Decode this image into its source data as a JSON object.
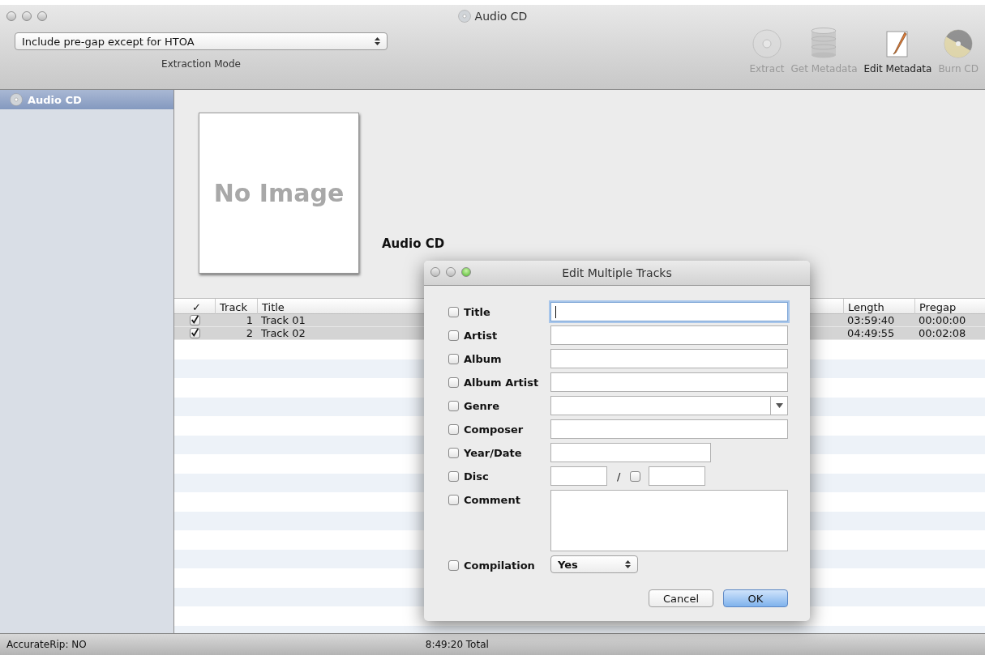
{
  "window": {
    "title": "Audio CD"
  },
  "toolbar": {
    "extraction_mode": {
      "value": "Include pre-gap except for HTOA",
      "label": "Extraction Mode"
    },
    "buttons": [
      {
        "kind": "extract",
        "label": "Extract",
        "disabled": true
      },
      {
        "kind": "metadata",
        "label": "Get Metadata",
        "disabled": true
      },
      {
        "kind": "edit",
        "label": "Edit Metadata",
        "disabled": false
      },
      {
        "kind": "burn",
        "label": "Burn CD",
        "disabled": true
      }
    ]
  },
  "sidebar": {
    "items": [
      {
        "label": "Audio CD",
        "selected": true
      }
    ]
  },
  "album": {
    "image_placeholder": "No Image",
    "title": "Audio CD"
  },
  "table": {
    "columns": [
      "✓",
      "Track",
      "Title",
      "Length",
      "Pregap"
    ],
    "rows": [
      {
        "checked": true,
        "selected": true,
        "track": "1",
        "title": "Track 01",
        "length": "03:59:40",
        "pregap": "00:00:00"
      },
      {
        "checked": true,
        "selected": true,
        "track": "2",
        "title": "Track 02",
        "length": "04:49:55",
        "pregap": "00:02:08"
      }
    ]
  },
  "status_bar": {
    "left": "AccurateRip: NO",
    "center": "8:49:20 Total"
  },
  "dialog": {
    "title": "Edit Multiple Tracks",
    "fields": [
      {
        "kind": "text",
        "label": "Title",
        "checked": false,
        "focused": true
      },
      {
        "kind": "text",
        "label": "Artist",
        "checked": false,
        "focused": false
      },
      {
        "kind": "text",
        "label": "Album",
        "checked": false,
        "focused": false
      },
      {
        "kind": "text",
        "label": "Album Artist",
        "checked": false,
        "focused": false
      },
      {
        "kind": "combo",
        "label": "Genre",
        "checked": false,
        "focused": false
      },
      {
        "kind": "text",
        "label": "Composer",
        "checked": false,
        "focused": false
      },
      {
        "kind": "short",
        "label": "Year/Date",
        "checked": false,
        "focused": false
      },
      {
        "kind": "disc",
        "label": "Disc",
        "checked": false,
        "focused": false,
        "separator": "/",
        "total_checked": false
      },
      {
        "kind": "textarea",
        "label": "Comment",
        "checked": false,
        "focused": false
      },
      {
        "kind": "popup",
        "label": "Compilation",
        "checked": false,
        "value": "Yes"
      }
    ],
    "buttons": [
      {
        "label": "Cancel",
        "default": false
      },
      {
        "label": "OK",
        "default": true
      }
    ]
  }
}
